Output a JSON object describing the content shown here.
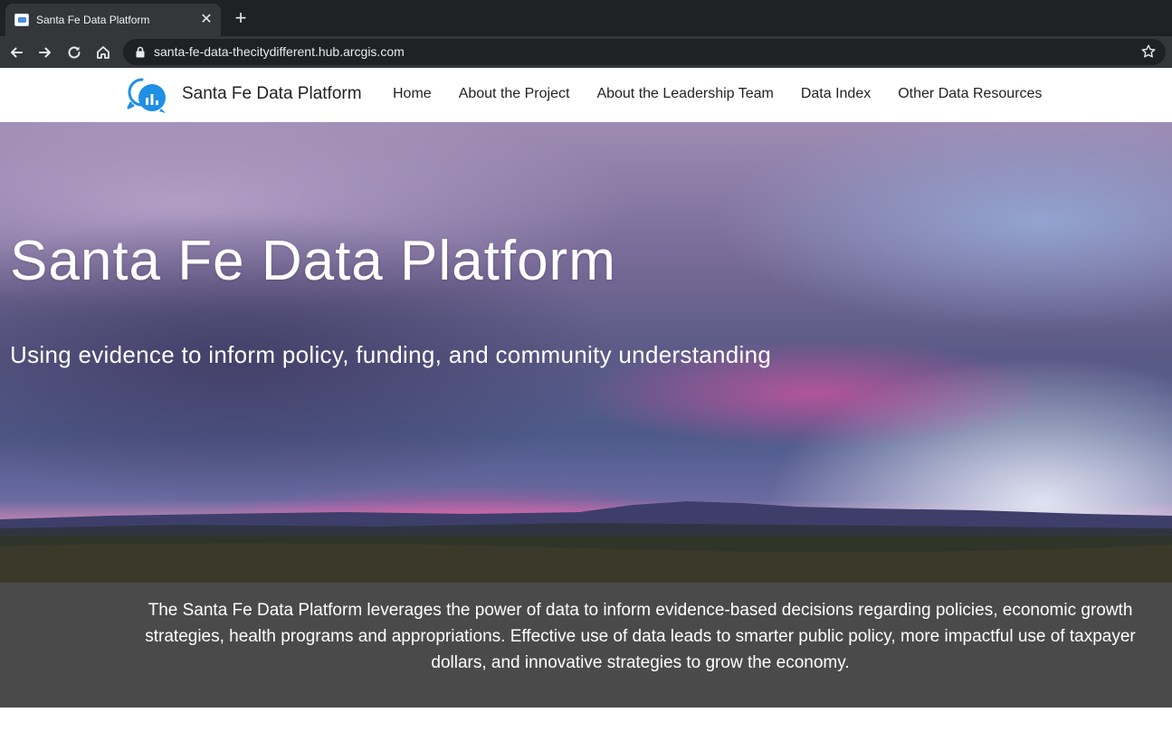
{
  "browser": {
    "tab_title": "Santa Fe Data Platform",
    "tab_close_glyph": "✕",
    "new_tab_glyph": "+",
    "url": "santa-fe-data-thecitydifferent.hub.arcgis.com",
    "icons": [
      "back-icon",
      "forward-icon",
      "reload-icon",
      "home-icon",
      "lock-icon",
      "bookmark-star-icon"
    ]
  },
  "site": {
    "name": "Santa Fe Data Platform",
    "logo_icon": "chat-bubble-bar-chart-icon",
    "nav": [
      {
        "label": "Home"
      },
      {
        "label": "About the Project"
      },
      {
        "label": "About the Leadership Team"
      },
      {
        "label": "Data Index"
      },
      {
        "label": "Other Data Resources"
      }
    ]
  },
  "hero": {
    "title": "Santa Fe Data Platform",
    "subtitle": "Using evidence to inform policy, funding, and community understanding"
  },
  "description": {
    "text": "The Santa Fe Data Platform leverages the power of data to inform evidence-based decisions regarding policies, economic growth strategies, health programs and appropriations. Effective use of data leads to smarter public policy, more impactful use of taxpayer dollars, and innovative strategies to grow the economy."
  },
  "colors": {
    "chrome_dark": "#202124",
    "chrome_tab": "#35363a",
    "logo_blue": "#1f8fe6",
    "band_gray": "#4a4a4a"
  }
}
